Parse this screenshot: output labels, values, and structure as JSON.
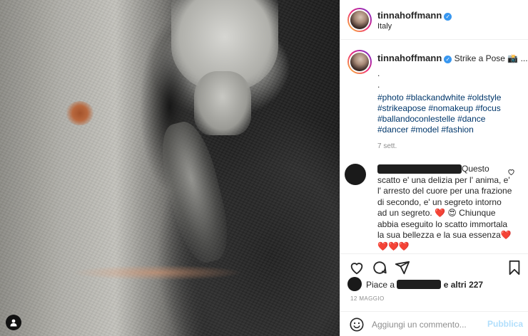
{
  "post": {
    "username": "tinnahoffmann",
    "location": "Italy",
    "caption_text": "Strike a Pose 📸 ...",
    "caption_dots": [
      ".",
      "."
    ],
    "hashtags": [
      "#photo #blackandwhite #oldstyle",
      "#strikeapose #nomakeup #focus",
      "#ballandoconlestelle #dance",
      "#dancer #model #fashion"
    ],
    "caption_time": "7 sett."
  },
  "comment": {
    "text_first": "Questo",
    "text_rest": "scatto e' una delizia per l' anima, e' l' arresto del cuore per una frazione di secondo, e' un segreto intorno ad un segreto. ❤️ 😍 Chiunque abbia eseguito lo scatto immortala la sua bellezza e la sua essenza❤️❤️❤️❤️"
  },
  "likes": {
    "prefix": "Piace a",
    "suffix": "e altri 227"
  },
  "date": "12 MAGGIO",
  "add_comment": {
    "placeholder": "Aggiungi un commento...",
    "publish_label": "Pubblica"
  },
  "icons": {
    "verified": "verified-badge",
    "like": "heart-icon",
    "comment": "comment-icon",
    "share": "share-icon",
    "save": "bookmark-icon",
    "emoji": "emoji-icon",
    "user_tag": "user-tag-icon"
  },
  "colors": {
    "hashtag": "#00376b",
    "verified": "#3897f0",
    "publish_disabled": "#b2dffc",
    "muted": "#8e8e8e"
  }
}
